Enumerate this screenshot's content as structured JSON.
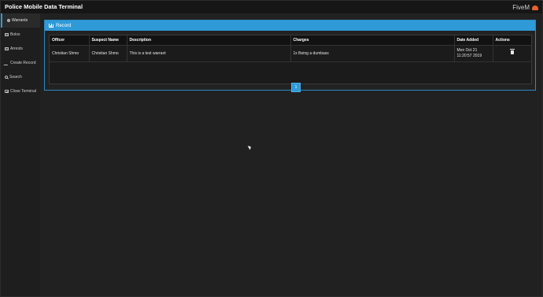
{
  "app": {
    "title": "Police Mobile Data Terminal",
    "brand": "FiveM",
    "brand_icon": "fivem-logo-icon",
    "accent_color": "#2f9ad8"
  },
  "sidebar": {
    "items": [
      {
        "label": "Warrants",
        "icon": "dot-icon",
        "active": true
      },
      {
        "label": "Bolos",
        "icon": "id-card-icon",
        "active": false
      },
      {
        "label": "Arrests",
        "icon": "id-card-icon",
        "active": false
      },
      {
        "label": "Create Record",
        "icon": "pencil-icon",
        "active": false
      },
      {
        "label": "Search",
        "icon": "search-icon",
        "active": false
      },
      {
        "label": "Close Terminal",
        "icon": "close-terminal-icon",
        "active": false
      }
    ]
  },
  "panel": {
    "title": "Record",
    "icon": "bar-chart-icon"
  },
  "table": {
    "columns": [
      "Officer",
      "Suspect Name",
      "Description",
      "Charges",
      "Date Added",
      "Actions"
    ],
    "rows": [
      {
        "officer": "Christian Shmo",
        "suspect": "Christian Shmo",
        "description": "This is a test warrant",
        "charges": "1x Being a dumbass",
        "date_line1": "Mon Oct 21",
        "date_line2": "11:20:57 2019",
        "action_icon": "trash-icon"
      }
    ]
  },
  "pagination": {
    "current_page": "1"
  }
}
